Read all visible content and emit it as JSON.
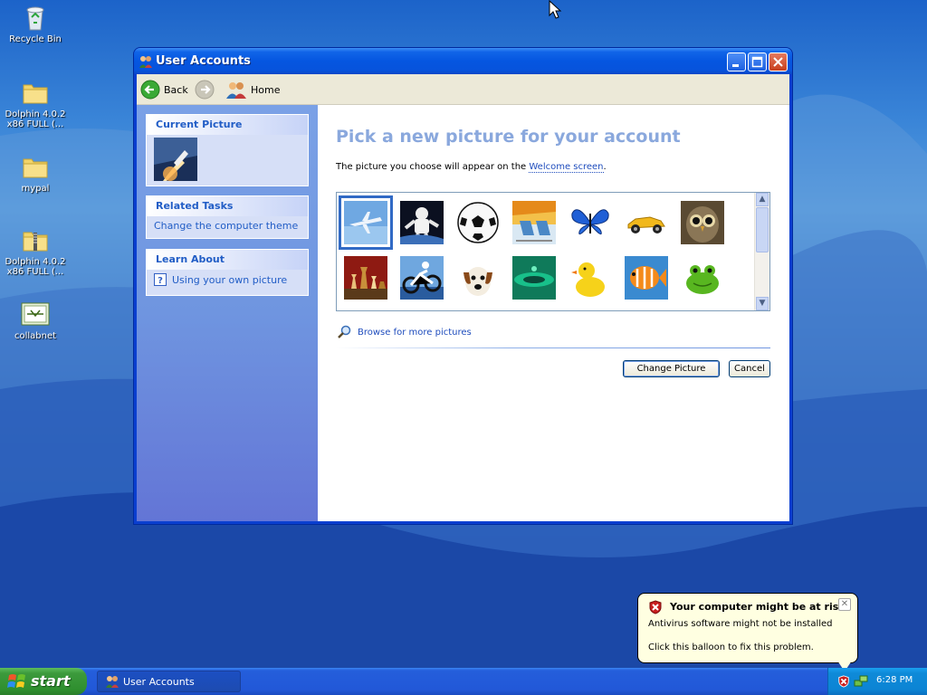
{
  "desktop": {
    "icons": [
      {
        "label": "Recycle Bin"
      },
      {
        "label": "Dolphin 4.0.2 x86 FULL (..."
      },
      {
        "label": "mypal"
      },
      {
        "label": "Dolphin 4.0.2 x86 FULL (..."
      },
      {
        "label": "collabnet"
      }
    ]
  },
  "window": {
    "title": "User Accounts",
    "toolbar": {
      "back_label": "Back",
      "home_label": "Home"
    },
    "left_pane": {
      "current_picture": {
        "header": "Current Picture"
      },
      "related_tasks": {
        "header": "Related Tasks",
        "items": [
          "Change the computer theme"
        ]
      },
      "learn_about": {
        "header": "Learn About",
        "items": [
          "Using your own picture"
        ]
      }
    },
    "main": {
      "heading": "Pick a new picture for your account",
      "description_prefix": "The picture you choose will appear on the ",
      "description_link": "Welcome screen",
      "description_suffix": ".",
      "pictures": [
        {
          "name": "airplane",
          "selected": true
        },
        {
          "name": "astronaut"
        },
        {
          "name": "soccer ball"
        },
        {
          "name": "beach chairs"
        },
        {
          "name": "butterfly"
        },
        {
          "name": "race car"
        },
        {
          "name": "owl"
        },
        {
          "name": "chess"
        },
        {
          "name": "dirt bike"
        },
        {
          "name": "dog"
        },
        {
          "name": "green drops"
        },
        {
          "name": "rubber duck"
        },
        {
          "name": "fish"
        },
        {
          "name": "frog"
        }
      ],
      "browse_label": "Browse for more pictures",
      "change_button": "Change Picture",
      "cancel_button": "Cancel"
    }
  },
  "balloon": {
    "title": "Your computer might be at risk",
    "line1": "Antivirus software might not be installed",
    "line2": "Click this balloon to fix this problem."
  },
  "taskbar": {
    "start_label": "start",
    "task_button": "User Accounts",
    "clock": "6:28 PM"
  },
  "colors": {
    "title_bar": "#0556e0",
    "left_pane": "#6f95e0",
    "heading": "#8aa8dd",
    "link": "#1f4dbd",
    "balloon_bg": "#ffffe1",
    "start_green": "#3c9a3c"
  }
}
